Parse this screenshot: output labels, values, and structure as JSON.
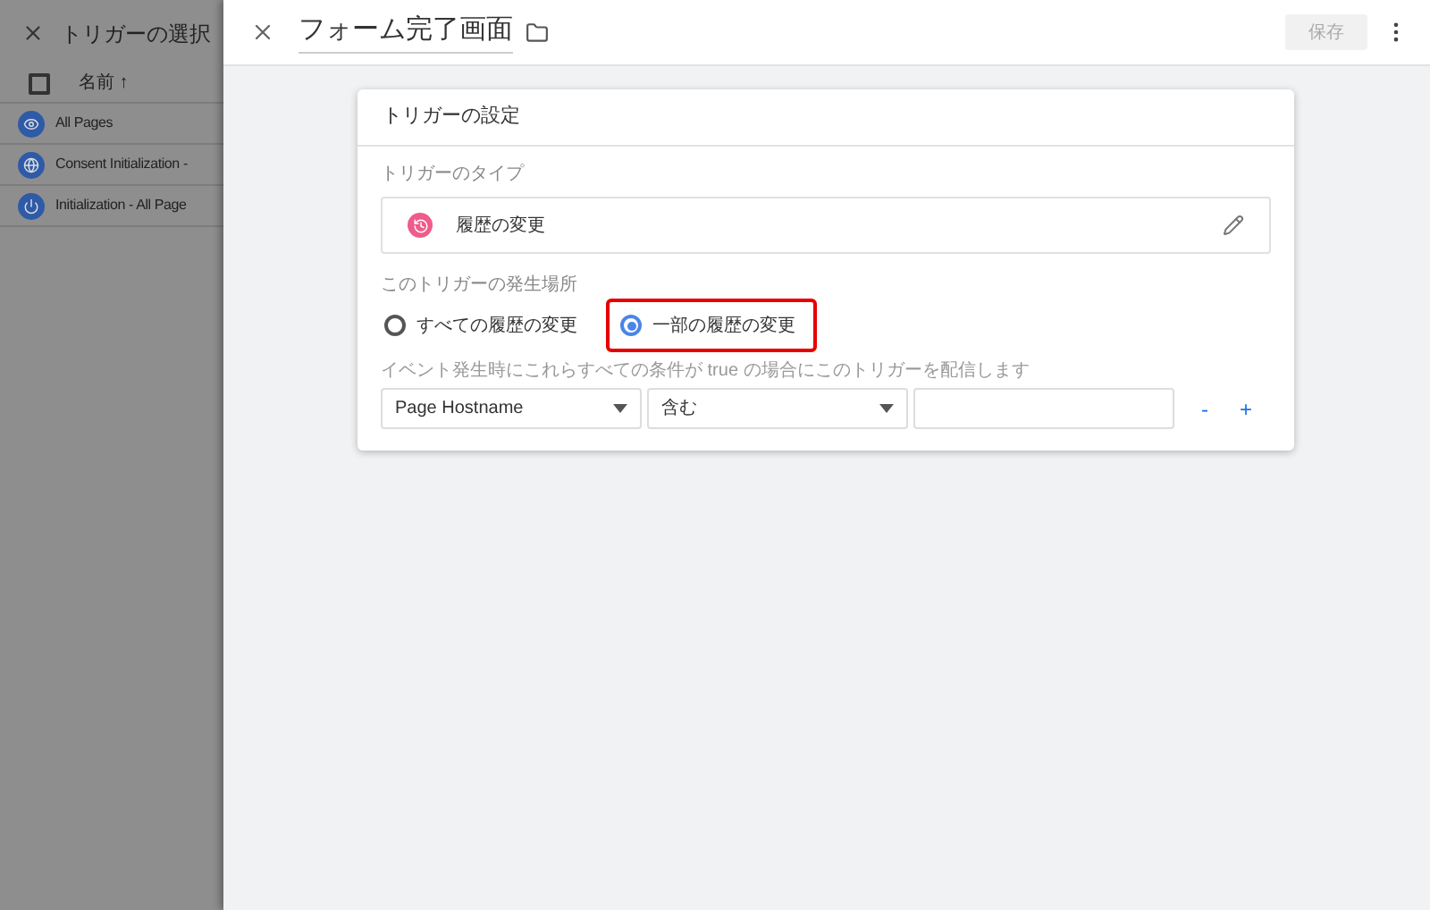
{
  "back_panel": {
    "title": "トリガーの選択",
    "column_header": "名前 ↑",
    "select_all_checked": false,
    "rows": [
      {
        "kind": "eye",
        "name": "All Pages"
      },
      {
        "kind": "globe",
        "name": "Consent Initialization -"
      },
      {
        "kind": "power",
        "name": "Initialization - All Page"
      }
    ]
  },
  "header": {
    "title": "フォーム完了画面",
    "save_label": "保存",
    "save_disabled": true
  },
  "card": {
    "title": "トリガーの設定",
    "type_label": "トリガーのタイプ",
    "type_value": "履歴の変更",
    "fires_on_label": "このトリガーの発生場所",
    "options": [
      {
        "label": "すべての履歴の変更",
        "selected": false,
        "highlighted": false
      },
      {
        "label": "一部の履歴の変更",
        "selected": true,
        "highlighted": true
      }
    ],
    "condition_label": "イベント発生時にこれらすべての条件が true の場合にこのトリガーを配信します",
    "condition": {
      "variable": "Page Hostname",
      "operator": "含む"
    },
    "remove_label": "-",
    "add_label": "+"
  }
}
